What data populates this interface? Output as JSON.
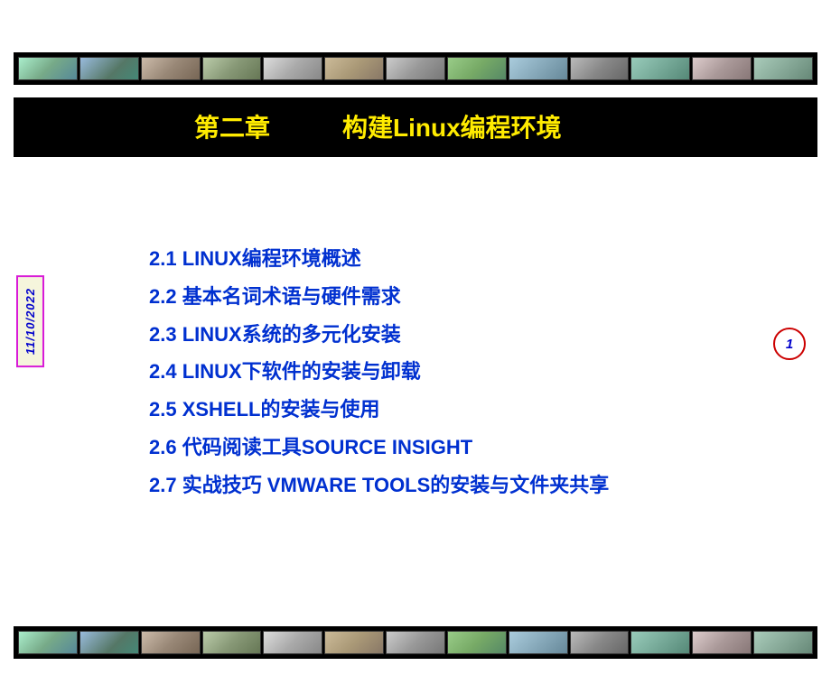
{
  "header": {
    "chapter": "第二章",
    "title": "构建Linux编程环境"
  },
  "date": "11/10/2022",
  "page_number": "1",
  "toc": [
    "2.1 LINUX编程环境概述",
    "2.2 基本名词术语与硬件需求",
    "2.3  LINUX系统的多元化安装",
    "2.4 LINUX下软件的安装与卸载",
    "2.5 XSHELL的安装与使用",
    "2.6 代码阅读工具SOURCE INSIGHT",
    "2.7 实战技巧 VMWARE TOOLS的安装与文件夹共享"
  ]
}
